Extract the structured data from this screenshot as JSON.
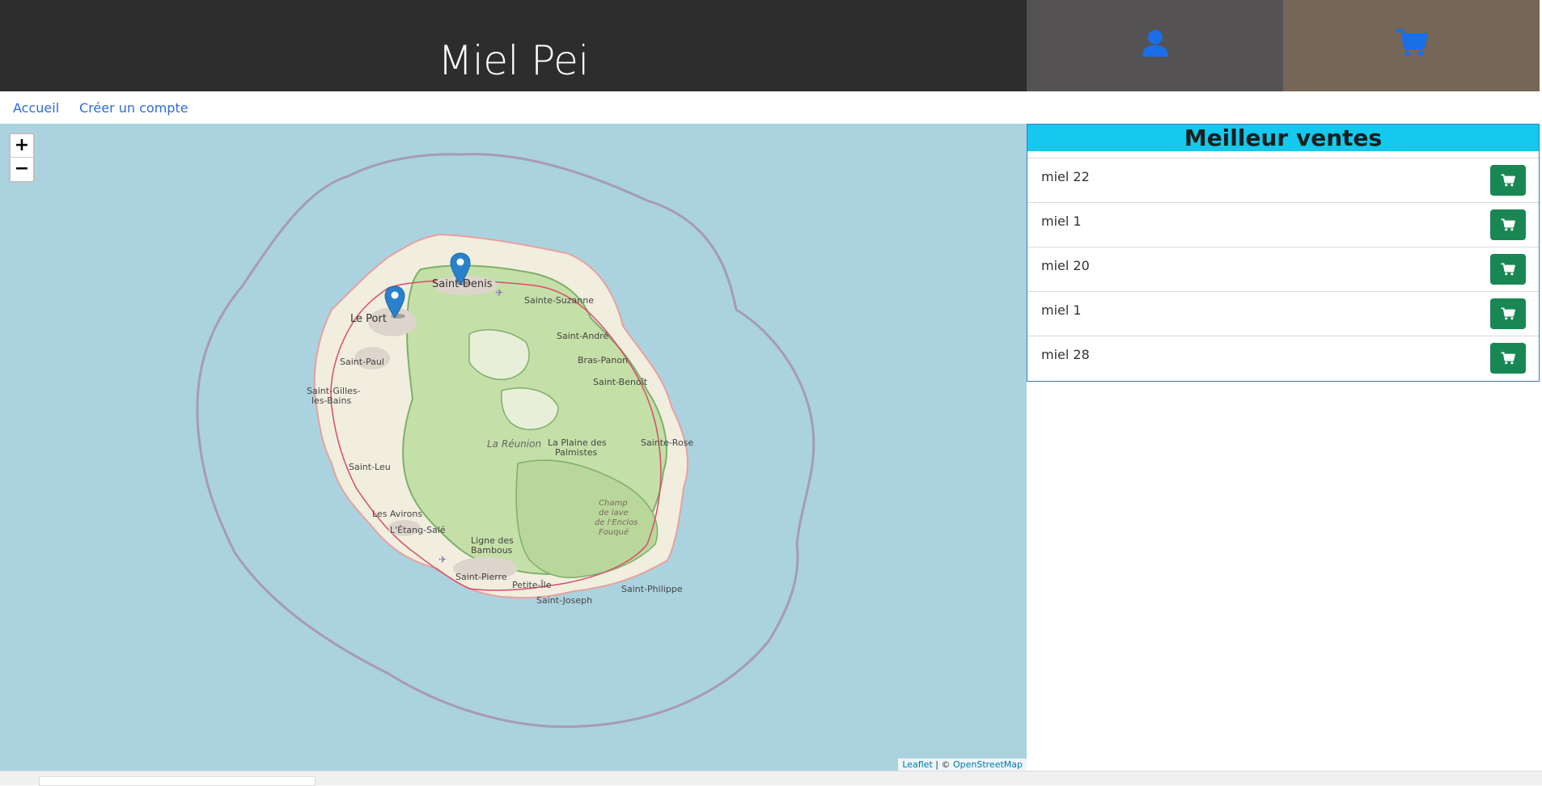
{
  "header": {
    "title": "Miel Pei",
    "account_icon": "user-icon",
    "cart_icon": "cart-icon",
    "colors": {
      "title_bg": "#2d2d2d",
      "account_bg": "#545253",
      "cart_bg": "#756657",
      "icon": "#1a6ee8"
    }
  },
  "nav": {
    "home": "Accueil",
    "signup": "Créer un compte"
  },
  "map": {
    "zoom_in": "+",
    "zoom_out": "−",
    "attribution_leaflet": "Leaflet",
    "attribution_sep": " | © ",
    "attribution_osm": "OpenStreetMap",
    "markers": [
      "Saint-Denis marker",
      "Le Port marker"
    ],
    "labels": {
      "saint_denis": "Saint-Denis",
      "le_port": "Le Port",
      "sainte_suzanne": "Sainte-Suzanne",
      "saint_andre": "Saint-André",
      "bras_panon": "Bras-Panon",
      "saint_benoit": "Saint-Benoît",
      "saint_paul": "Saint-Paul",
      "saint_gilles": "Saint-Gilles-",
      "les_bains": "les-Bains",
      "la_reunion": "La Réunion",
      "plaine_1": "La Plaine des",
      "plaine_2": "Palmistes",
      "sainte_rose": "Sainte-Rose",
      "saint_leu": "Saint-Leu",
      "champ_1": "Champ",
      "champ_2": "de lave",
      "champ_3": "de l'Enclos",
      "champ_4": "Fouqué",
      "les_avirons": "Les Avirons",
      "etang_sale": "L'Étang-Salé",
      "ligne_1": "Ligne des",
      "ligne_2": "Bambous",
      "saint_pierre": "Saint-Pierre",
      "petite_ile": "Petite-Île",
      "saint_philippe": "Saint-Philippe",
      "saint_joseph": "Saint-Joseph"
    }
  },
  "bestsellers": {
    "title": "Meilleur ventes",
    "items": [
      {
        "name": "miel 22"
      },
      {
        "name": "miel 1"
      },
      {
        "name": "miel 20"
      },
      {
        "name": "miel 1"
      },
      {
        "name": "miel 28"
      }
    ],
    "button_icon": "cart-icon",
    "colors": {
      "title_bg": "#14c8ee",
      "button_bg": "#198754"
    }
  }
}
